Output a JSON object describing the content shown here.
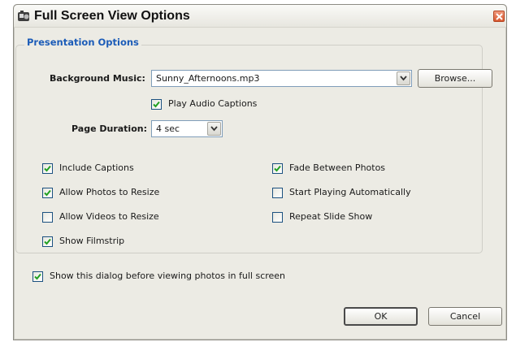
{
  "window": {
    "title": "Full Screen View Options"
  },
  "group": {
    "label": "Presentation Options"
  },
  "music": {
    "label": "Background Music:",
    "value": "Sunny_Afternoons.mp3",
    "browse_label": "Browse..."
  },
  "play_audio": {
    "label": "Play Audio Captions",
    "checked": true
  },
  "duration": {
    "label": "Page Duration:",
    "value": "4 sec"
  },
  "options": [
    {
      "label": "Include Captions",
      "checked": true
    },
    {
      "label": "Allow Photos to Resize",
      "checked": true
    },
    {
      "label": "Allow Videos to Resize",
      "checked": false
    },
    {
      "label": "Show Filmstrip",
      "checked": true
    },
    {
      "label": "Fade Between Photos",
      "checked": true
    },
    {
      "label": "Start Playing Automatically",
      "checked": false
    },
    {
      "label": "Repeat Slide Show",
      "checked": false
    }
  ],
  "show_dialog": {
    "label": "Show this dialog before viewing photos in full screen",
    "checked": true
  },
  "buttons": {
    "ok": "OK",
    "cancel": "Cancel"
  },
  "colors": {
    "legend": "#1c5cb8",
    "close": "#d9582f",
    "check": "#22a022"
  }
}
